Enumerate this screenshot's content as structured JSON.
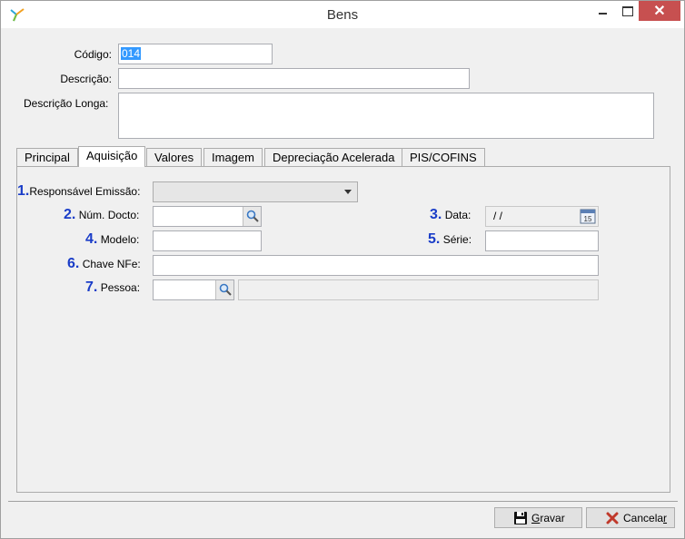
{
  "window": {
    "title": "Bens"
  },
  "form": {
    "codigo_label": "Código:",
    "codigo_value": "014",
    "descricao_label": "Descrição:",
    "descricao_value": "",
    "descricao_longa_label": "Descrição Longa:",
    "descricao_longa_value": ""
  },
  "tabs": [
    {
      "label": "Principal"
    },
    {
      "label": "Aquisição"
    },
    {
      "label": "Valores"
    },
    {
      "label": "Imagem"
    },
    {
      "label": "Depreciação Acelerada"
    },
    {
      "label": "PIS/COFINS"
    }
  ],
  "aquisicao": {
    "f1_num": "1.",
    "f1_label": "Responsável Emissão:",
    "f2_num": "2.",
    "f2_label": "Núm. Docto:",
    "f3_num": "3.",
    "f3_label": "Data:",
    "f3_value": " /  /",
    "f4_num": "4.",
    "f4_label": "Modelo:",
    "f5_num": "5.",
    "f5_label": "Série:",
    "f6_num": "6.",
    "f6_label": "Chave NFe:",
    "f7_num": "7.",
    "f7_label": "Pessoa:"
  },
  "footer": {
    "gravar_prefix": "",
    "gravar_accel": "G",
    "gravar_rest": "ravar",
    "cancelar_prefix": "Cancela",
    "cancelar_accel": "r",
    "cancelar_rest": ""
  }
}
